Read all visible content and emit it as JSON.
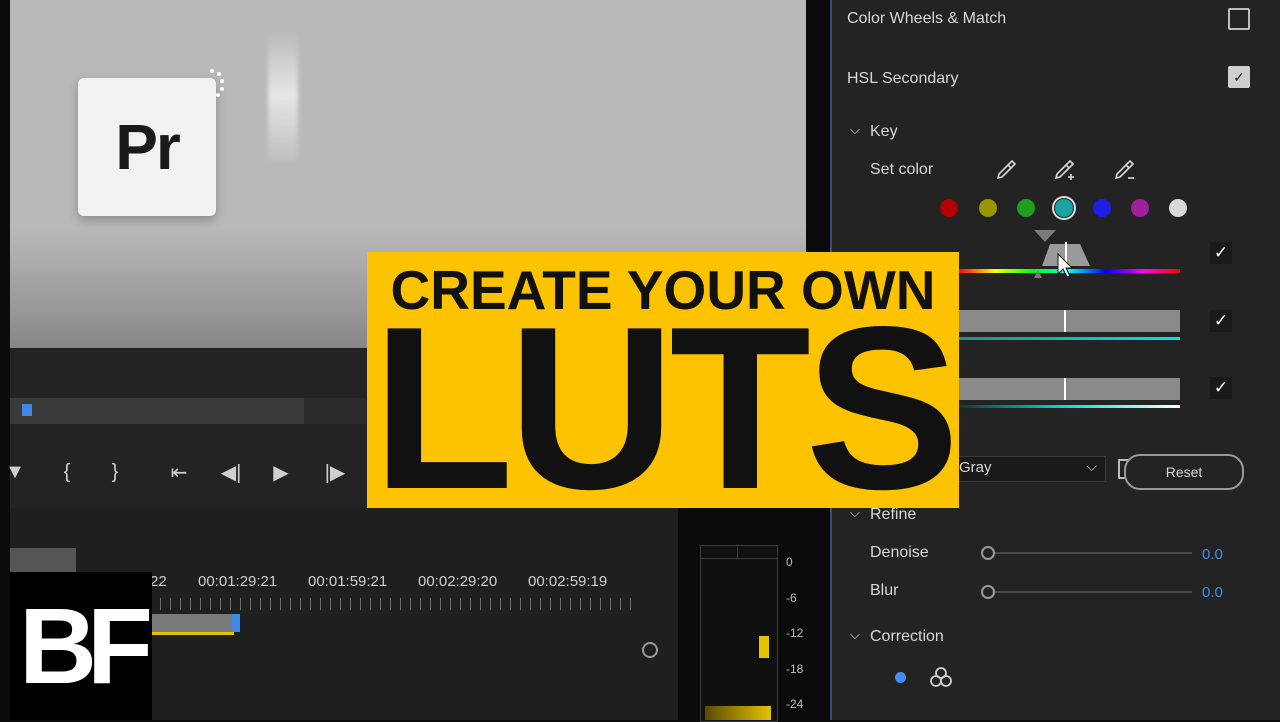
{
  "logo": {
    "app_label": "Pr",
    "brand_label": "BF"
  },
  "title": {
    "line1": "CREATE YOUR OWN",
    "line2": "LUTS"
  },
  "timeline": {
    "timecodes": [
      "22",
      "00:01:29:21",
      "00:01:59:21",
      "00:02:29:20",
      "00:02:59:19"
    ]
  },
  "meter": {
    "db_labels": [
      "0",
      "-6",
      "-12",
      "-18",
      "-24"
    ]
  },
  "lumetri": {
    "color_wheels_label": "Color Wheels & Match",
    "hsl_secondary_label": "HSL Secondary",
    "key_label": "Key",
    "set_color_label": "Set color",
    "swatch_colors": [
      "#b40000",
      "#9a9600",
      "#1e9e1e",
      "#1aa5a5",
      "#1e1ee6",
      "#a01ea0",
      "#d8d8d8"
    ],
    "gray_option": "Gray",
    "reset_label": "Reset",
    "refine_label": "Refine",
    "denoise_label": "Denoise",
    "denoise_value": "0.0",
    "blur_label": "Blur",
    "blur_value": "0.0",
    "correction_label": "Correction"
  },
  "colors": {
    "accent_blue": "#3f8ef0",
    "title_yellow": "#fdc300",
    "clip_yellow": "#e2c400"
  }
}
